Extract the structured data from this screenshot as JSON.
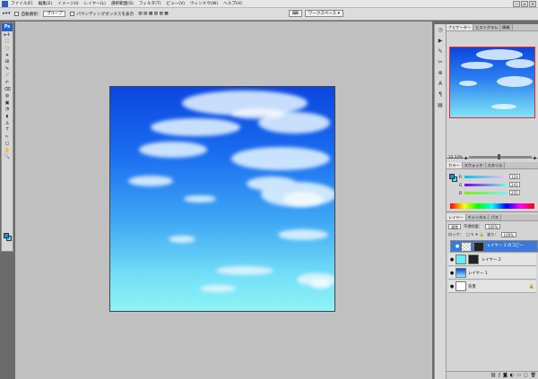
{
  "menu": {
    "items": [
      "ファイル(F)",
      "編集(E)",
      "イメージ(I)",
      "レイヤー(L)",
      "選択範囲(S)",
      "フィルタ(T)",
      "ビュー(V)",
      "ウィンドウ(W)",
      "ヘルプ(H)"
    ]
  },
  "options": {
    "auto_select_label": "自動選択：",
    "auto_select_value": "グループ",
    "bbox_label": "バウンディングボックスを表示",
    "workspace_label": "ワークスペース ▾"
  },
  "tools": {
    "logo": "Ps",
    "icons": [
      "▸✛",
      "⬚",
      "◌",
      "✦",
      "⊞",
      "✎",
      "⟋",
      "✍",
      "⌫",
      "◍",
      "▣",
      "◔",
      "◖",
      "⚓",
      "T",
      "↖",
      "◻",
      "✋",
      "🔍"
    ]
  },
  "navigator": {
    "tabs": [
      "ナビゲーター",
      "ヒストグラム",
      "情報"
    ],
    "zoom": "33.33%"
  },
  "color": {
    "tabs": [
      "カラー",
      "スウォッチ",
      "スタイル"
    ],
    "channels": [
      {
        "letter": "R",
        "value": "119",
        "bar": "linear-gradient(90deg,#00c0f0,#ffc0f0)"
      },
      {
        "letter": "G",
        "value": "243",
        "bar": "linear-gradient(90deg,#7700f0,#77fff0)"
      },
      {
        "letter": "B",
        "value": "255",
        "bar": "linear-gradient(90deg,#77f300,#77f3ff)"
      }
    ]
  },
  "layers": {
    "tabs": [
      "レイヤー",
      "チャンネル",
      "パス"
    ],
    "blend_mode": "通常",
    "opacity_label": "不透明度：",
    "opacity_value": "100%",
    "lock_label": "ロック：",
    "fill_label": "塗り：",
    "fill_value": "100%",
    "items": [
      {
        "name": "レイヤー 2 のコピー",
        "selected": true,
        "thumb": "#3b7ad9",
        "mask": true
      },
      {
        "name": "レイヤー 2",
        "selected": false,
        "thumb": "#5ff0f0",
        "mask": true
      },
      {
        "name": "レイヤー 1",
        "selected": false,
        "thumb": "#1a6df0",
        "mask": false
      },
      {
        "name": "背景",
        "selected": false,
        "thumb": "#ffffff",
        "mask": false
      }
    ]
  }
}
